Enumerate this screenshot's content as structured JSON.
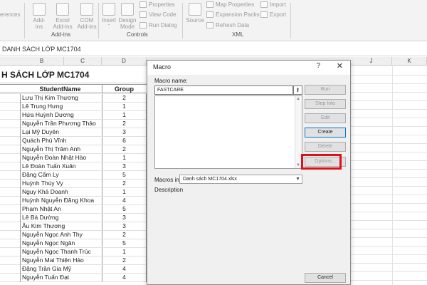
{
  "ribbon": {
    "partial_left_label": "erences",
    "addins_group": {
      "label": "Add-ins",
      "buttons": [
        {
          "label": "Add-\nins",
          "icon": "addins-icon"
        },
        {
          "label": "Excel\nAdd-ins",
          "icon": "excel-addins-icon"
        },
        {
          "label": "COM\nAdd-ins",
          "icon": "com-addins-icon"
        }
      ]
    },
    "controls_group": {
      "label": "Controls",
      "buttons": [
        {
          "label": "Insert\n˅",
          "icon": "insert-icon"
        },
        {
          "label": "Design\nMode",
          "icon": "design-mode-icon"
        }
      ],
      "small": [
        "Properties",
        "View Code",
        "Run Dialog"
      ]
    },
    "xml_group": {
      "label": "XML",
      "buttons": [
        {
          "label": "Source",
          "icon": "source-icon"
        }
      ],
      "small": [
        "Map Properties",
        "Expansion Packs",
        "Refresh Data",
        "Import",
        "Export"
      ]
    }
  },
  "formula_bar": {
    "text": "DANH SÁCH LỚP MC1704"
  },
  "columns": [
    "B",
    "C",
    "D",
    "E",
    "F",
    "G",
    "H",
    "I",
    "J",
    "K"
  ],
  "sheet": {
    "title": "H SÁCH LỚP MC1704",
    "header": {
      "name": "StudentName",
      "group": "Group"
    },
    "rows": [
      {
        "name": "Lưu Thị Kim Thương",
        "group": "2"
      },
      {
        "name": "Lê Trung Hưng",
        "group": "1"
      },
      {
        "name": "Hứa Huỳnh Dương",
        "group": "1"
      },
      {
        "name": "Nguyễn Trần Phương Thảo",
        "group": "2"
      },
      {
        "name": "Lại Mỹ Duyên",
        "group": "3"
      },
      {
        "name": "Quách Phú Vĩnh",
        "group": "6"
      },
      {
        "name": "Nguyễn Thị Trâm Anh",
        "group": "2"
      },
      {
        "name": "Nguyễn Đoàn Nhật Hào",
        "group": "1"
      },
      {
        "name": "Lê Đoàn Tuấn Xuân",
        "group": "3"
      },
      {
        "name": "Đặng Cẩm Ly",
        "group": "5"
      },
      {
        "name": "Huỳnh Thúy Vy",
        "group": "2"
      },
      {
        "name": "Nguy Khả Doanh",
        "group": "1"
      },
      {
        "name": "Huỳnh Nguyễn Đăng Khoa",
        "group": "4"
      },
      {
        "name": "Phạm Nhật An",
        "group": "5"
      },
      {
        "name": "Lê Bá Dường",
        "group": "3"
      },
      {
        "name": "Âu Kim Thương",
        "group": "3"
      },
      {
        "name": "Nguyễn Ngọc Anh Thy",
        "group": "2"
      },
      {
        "name": "Nguyễn Ngọc Ngân",
        "group": "5"
      },
      {
        "name": "Nguyễn Ngọc Thanh Trúc",
        "group": "1"
      },
      {
        "name": "Nguyễn Mai Thiện Hào",
        "group": "2"
      },
      {
        "name": "Đặng Trần Gia Mỹ",
        "group": "4"
      },
      {
        "name": "Nguyễn Tuấn Đạt",
        "group": "4"
      }
    ]
  },
  "dialog": {
    "title": "Macro",
    "help": "?",
    "close": "✕",
    "macro_name_label": "Macro name:",
    "macro_name_value": "FASTCARE",
    "upload_glyph": "⭱",
    "macros_in_label": "Macros in:",
    "macros_in_value": "Danh sách MC1704.xlsx",
    "description_label": "Description",
    "buttons": {
      "run": "Run",
      "step_into": "Step Into",
      "edit": "Edit",
      "create": "Create",
      "delete": "Delete",
      "options": "Options...",
      "cancel": "Cancel"
    },
    "highlight_color": "#e0101a"
  }
}
